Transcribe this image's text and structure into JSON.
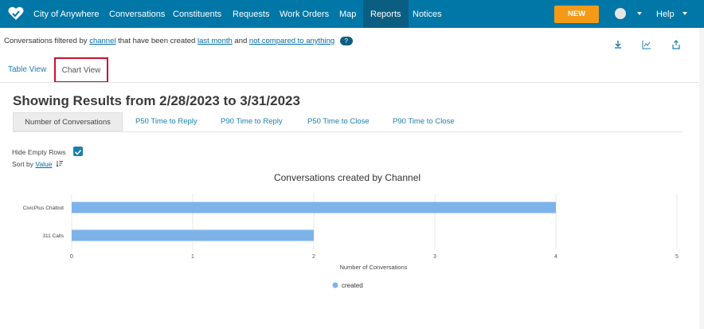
{
  "nav": {
    "brand": "City of Anywhere",
    "items": [
      "Conversations",
      "Constituents",
      "Requests",
      "Work Orders",
      "Map",
      "Reports",
      "Notices"
    ],
    "active": "Reports",
    "new_label": "NEW",
    "help_label": "Help",
    "bg": "#0077a7",
    "accent": "#f59a17"
  },
  "filter": {
    "prefix": "Conversations filtered by",
    "channel_link": "channel",
    "middle": "that have been created",
    "date_link": "last month",
    "and": "and",
    "compare_link": "not compared to anything",
    "help_badge": "?"
  },
  "toolbar_icons": [
    "download-icon",
    "chart-line-icon",
    "share-icon"
  ],
  "view_tabs": {
    "table": "Table View",
    "chart": "Chart View"
  },
  "results_title": "Showing Results from 2/28/2023 to 3/31/2023",
  "metric_tabs": [
    "Number of Conversations",
    "P50 Time to Reply",
    "P90 Time to Reply",
    "P50 Time to Close",
    "P90 Time to Close"
  ],
  "options": {
    "hide_empty_label": "Hide Empty Rows",
    "hide_empty_checked": true,
    "sort_label": "Sort by",
    "sort_value": "Value"
  },
  "chart_data": {
    "type": "bar",
    "orientation": "horizontal",
    "title": "Conversations created by Channel",
    "categories": [
      "CivicPlus Chatbot",
      "311 Calls"
    ],
    "series": [
      {
        "name": "created",
        "values": [
          4,
          2
        ],
        "color": "#7db3e8"
      }
    ],
    "xlabel": "Number of Conversations",
    "ylabel": "",
    "xlim": [
      0,
      5
    ],
    "xticks": [
      0,
      1,
      2,
      3,
      4,
      5
    ],
    "grid": true,
    "legend": "bottom-center"
  }
}
